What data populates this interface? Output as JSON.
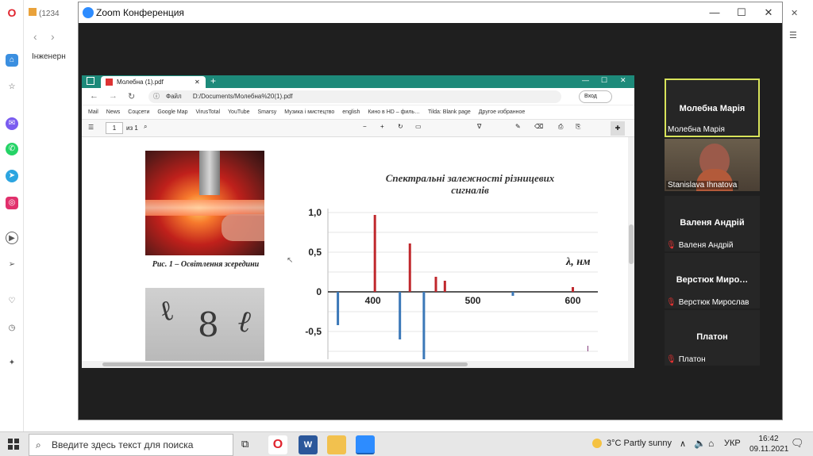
{
  "opera": {
    "tab_label": "(1234",
    "sidebar_tab_label": "Інженерн"
  },
  "zoom": {
    "title": "Zoom Конференция",
    "controls": {
      "minimize": "—",
      "maximize": "☐",
      "close": "✕"
    }
  },
  "edge": {
    "tab_title": "Молебна (1).pdf",
    "new_tab": "+",
    "address_label": "Файл",
    "address_value": "D:/Documents/Молебна%20(1).pdf",
    "profile_label": "Вход",
    "bookmarks": [
      "Mail",
      "News",
      "Соцсети",
      "Google Map",
      "VirusTotal",
      "YouTube",
      "Smarsy",
      "Музика і мистецтво",
      "english",
      "Кино в HD – филь…",
      "Tilda: Blank page",
      "Другое избранное"
    ],
    "pdf": {
      "page_value": "1",
      "page_total": "из 1"
    }
  },
  "document": {
    "figure1_caption": "Рис. 1 – Освітлення зсередини",
    "chart_title_line1": "Спектральні залежності різницевих",
    "chart_title_line2": "сигналів",
    "axis_label": "λ, нм"
  },
  "chart_data": {
    "type": "bar",
    "title": "Спектральні залежності різницевих сигналів",
    "xlabel": "λ, нм",
    "ylabel": "",
    "xlim": [
      355,
      625
    ],
    "ylim": [
      -0.85,
      1.05
    ],
    "xticks": [
      400,
      500,
      600
    ],
    "yticks": [
      1.0,
      0.5,
      0,
      -0.5
    ],
    "ytick_labels": [
      "1,0",
      "0,5",
      "0",
      "-0,5"
    ],
    "series": [
      {
        "color": "#c0282d",
        "x": [
          402,
          437,
          463,
          472,
          600
        ],
        "values": [
          0.97,
          0.61,
          0.19,
          0.14,
          0.06
        ]
      },
      {
        "color": "#3b78b8",
        "x": [
          365,
          427,
          451,
          540
        ],
        "values": [
          -0.42,
          -0.6,
          -0.85,
          -0.05
        ]
      }
    ]
  },
  "participants": [
    {
      "name": "Молебна Марія",
      "label": "Молебна Марія",
      "active": true,
      "muted": false
    },
    {
      "name": "",
      "label": "Stanislava Ihnatova",
      "active": false,
      "muted": false,
      "video": true
    },
    {
      "name": "Валеня Андрій",
      "label": "Валеня Андрій",
      "active": false,
      "muted": true
    },
    {
      "name": "Верстюк  Миро…",
      "label": "Верстюк Мирослав",
      "active": false,
      "muted": true
    },
    {
      "name": "Платон",
      "label": "Платон",
      "active": false,
      "muted": true
    }
  ],
  "taskbar": {
    "search_placeholder": "Введите здесь текст для поиска",
    "weather": "3°C  Partly sunny",
    "lang": "УКР",
    "time": "16:42",
    "date": "09.11.2021"
  },
  "colors": {
    "zoom_accent": "#2d8cff",
    "edge_tabbar": "#1d8a7a",
    "active_speaker": "#d8e35a",
    "bar_red": "#c0282d",
    "bar_blue": "#3b78b8"
  }
}
